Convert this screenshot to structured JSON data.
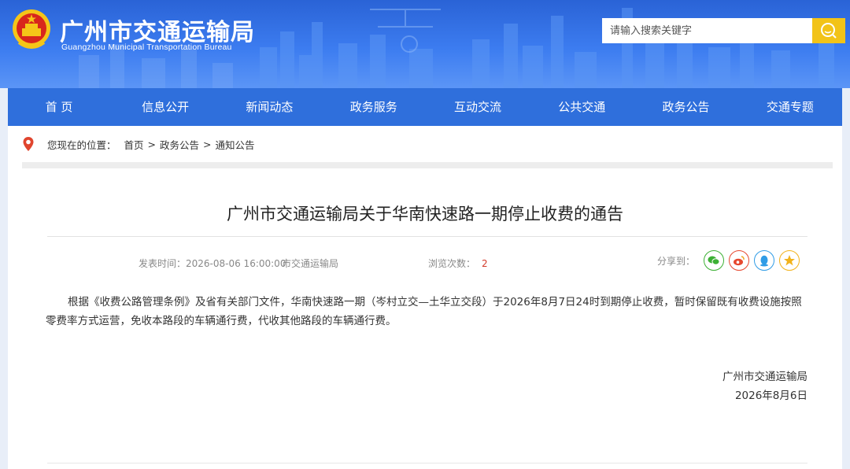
{
  "header": {
    "title": "广州市交通运输局",
    "subtitle": "Guangzhou Municipal Transportation Bureau",
    "search_placeholder": "请输入搜索关键字"
  },
  "nav": {
    "items": [
      {
        "label": "首 页"
      },
      {
        "label": "信息公开"
      },
      {
        "label": "新闻动态"
      },
      {
        "label": "政务服务"
      },
      {
        "label": "互动交流"
      },
      {
        "label": "公共交通"
      },
      {
        "label": "政务公告"
      },
      {
        "label": "交通专题"
      }
    ]
  },
  "breadcrumb": {
    "label": "您现在的位置：",
    "items": [
      "首页",
      "政务公告",
      "通知公告"
    ],
    "separator": ">"
  },
  "article": {
    "title": "广州市交通运输局关于华南快速路一期停止收费的通告",
    "publish_time": "发表时间：2026-08-06 16:00:00",
    "source": "市交通运输局",
    "views_label": "浏览次数：",
    "views_count": "2",
    "share_label": "分享到：",
    "body": "根据《收费公路管理条例》及省有关部门文件，华南快速路一期（岑村立交—土华立交段）于2026年8月7日24时到期停止收费，暂时保留既有收费设施按照零费率方式运营，免收本路段的车辆通行费，代收其他路段的车辆通行费。",
    "sign_org": "广州市交通运输局",
    "sign_date": "2026年8月6日"
  },
  "share_icons": [
    {
      "name": "wechat-icon",
      "color": "#3cb034"
    },
    {
      "name": "weibo-icon",
      "color": "#e6482f"
    },
    {
      "name": "qq-icon",
      "color": "#2f9ce6"
    },
    {
      "name": "qzone-icon",
      "color": "#f2b21b"
    }
  ],
  "colors": {
    "header_blue": "#3c7cf0",
    "nav_blue": "#2f6fdc",
    "search_button": "#f2c318",
    "views_red": "#d23a2a"
  }
}
